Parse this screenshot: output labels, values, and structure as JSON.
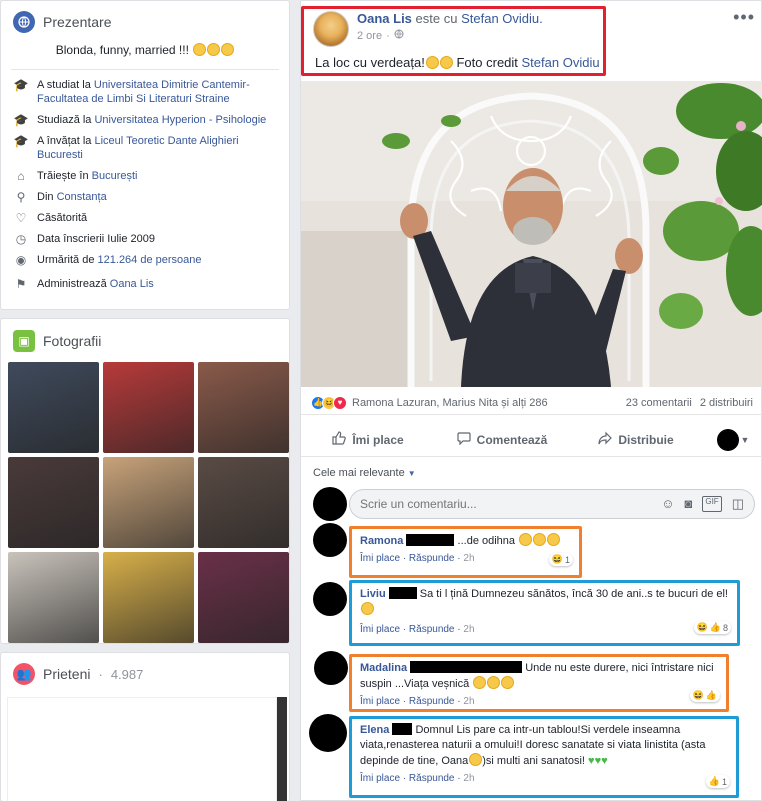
{
  "intro": {
    "title": "Prezentare",
    "bio": "Blonda, funny, married !!!",
    "items": [
      {
        "icon": "graduation-cap-icon",
        "prefix": "A studiat la ",
        "link": "Universitatea Dimitrie Cantemir-Facultatea de Limbi Si Literaturi Straine"
      },
      {
        "icon": "graduation-cap-icon",
        "prefix": "Studiază la ",
        "link": "Universitatea Hyperion - Psihologie"
      },
      {
        "icon": "graduation-cap-icon",
        "prefix": "A învățat la ",
        "link": "Liceul Teoretic Dante Alighieri Bucuresti"
      },
      {
        "icon": "home-icon",
        "prefix": "Trăiește în ",
        "link": "București"
      },
      {
        "icon": "location-pin-icon",
        "prefix": "Din ",
        "link": "Constanța"
      },
      {
        "icon": "heart-icon",
        "prefix": "Căsătorită",
        "link": ""
      },
      {
        "icon": "clock-icon",
        "prefix": "Data înscrierii Iulie 2009",
        "link": ""
      },
      {
        "icon": "rss-icon",
        "prefix": "Urmărită de ",
        "link": "121.264 de persoane"
      },
      {
        "icon": "flag-icon",
        "prefix": "Administrează ",
        "link": "Oana Lis"
      }
    ]
  },
  "photos": {
    "title": "Fotografii",
    "colors": [
      "#3f4a5c",
      "#b83a3a",
      "#8a5a4a",
      "#4a3a3a",
      "#c8a37a",
      "#5a4b44",
      "#c9c3bb",
      "#d8b04a",
      "#6a3048"
    ]
  },
  "friends": {
    "title": "Prieteni",
    "count": "4.987"
  },
  "post": {
    "author": "Oana Lis",
    "with_text": "este cu",
    "tagged": "Stefan Ovidiu.",
    "time": "2 ore",
    "text": "La loc cu verdeața!",
    "credit_prefix": "Foto credit ",
    "credit_name": "Stefan Ovidiu",
    "reactions_text": "Ramona Lazuran, Marius Nita și alți 286",
    "comments_count": "23 comentarii",
    "shares_count": "2 distribuiri",
    "like_label": "Îmi place",
    "comment_label": "Comentează",
    "share_label": "Distribuie"
  },
  "comments_section": {
    "filter_label": "Cele mai relevante",
    "input_placeholder": "Scrie un comentariu..."
  },
  "comments": [
    {
      "name": "Ramona",
      "text": "...de odihna",
      "like": "Îmi place",
      "reply": "Răspunde",
      "time": "2h",
      "reacts": "1",
      "border": "#f0802d"
    },
    {
      "name": "Liviu",
      "text": "Sa ti l țină Dumnezeu sănătos, încă 30 de ani..s te bucuri de el!",
      "like": "Îmi place",
      "reply": "Răspunde",
      "time": "2h",
      "reacts": "8",
      "border": "#1f9bd7"
    },
    {
      "name": "Madalina",
      "text": "Unde nu este durere, nici întristare nici suspin ...Viața veșnică",
      "like": "Îmi place",
      "reply": "Răspunde",
      "time": "2h",
      "reacts": "",
      "border": "#f0802d"
    },
    {
      "name": "Elena",
      "text": "Domnul Lis pare ca intr-un tablou!Si verdele inseamna viata,renasterea naturii a omului!I doresc sanatate si viata linistita (asta depinde de tine, Oana",
      "text2": ")si multi ani sanatosi!",
      "like": "Îmi place",
      "reply": "Răspunde",
      "time": "2h",
      "reacts": "1",
      "border": "#1f9bd7"
    }
  ]
}
